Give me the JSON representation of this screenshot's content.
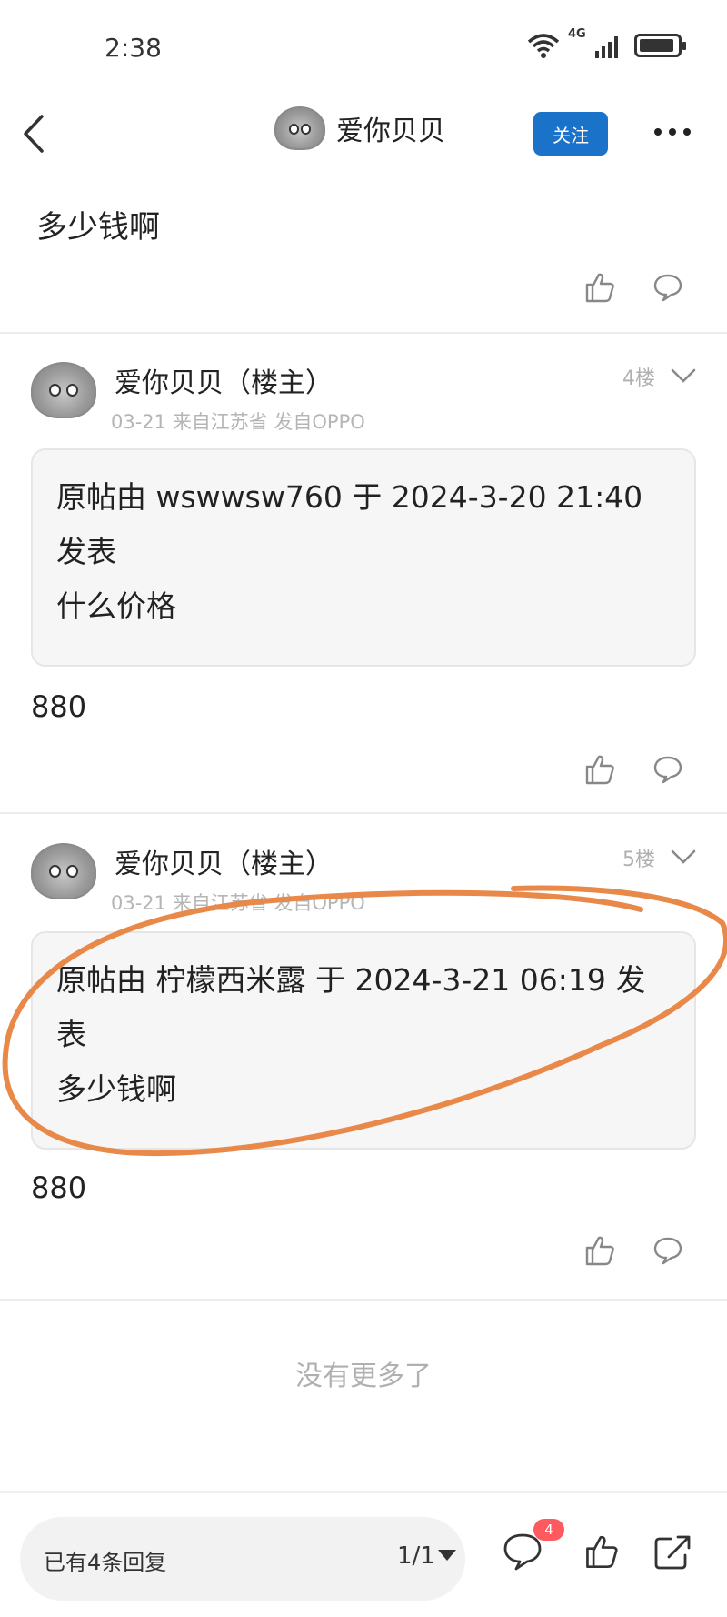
{
  "status_bar": {
    "time": "2:38",
    "network": "4G"
  },
  "nav": {
    "author_name": "爱你贝贝",
    "follow_label": "关注"
  },
  "top_post": {
    "text": "多少钱啊"
  },
  "floors": [
    {
      "author": "爱你贝贝（楼主）",
      "meta": "03-21 来自江苏省 发自OPPO",
      "floor_label": "4楼",
      "quote_header": "原帖由 wswwsw760 于 2024-3-20 21:40 发表",
      "quote_body": "什么价格",
      "reply": "880"
    },
    {
      "author": "爱你贝贝（楼主）",
      "meta": "03-21 来自江苏省 发自OPPO",
      "floor_label": "5楼",
      "quote_header": "原帖由 柠檬西米露 于 2024-3-21 06:19 发表",
      "quote_body": "多少钱啊",
      "reply": "880"
    }
  ],
  "no_more": "没有更多了",
  "bottom_bar": {
    "reply_count": "已有4条回复",
    "page": "1/1",
    "comment_badge": "4"
  },
  "colors": {
    "accent": "#1a73c9",
    "badge": "#ff5a5f",
    "highlight": "#e8894a"
  }
}
